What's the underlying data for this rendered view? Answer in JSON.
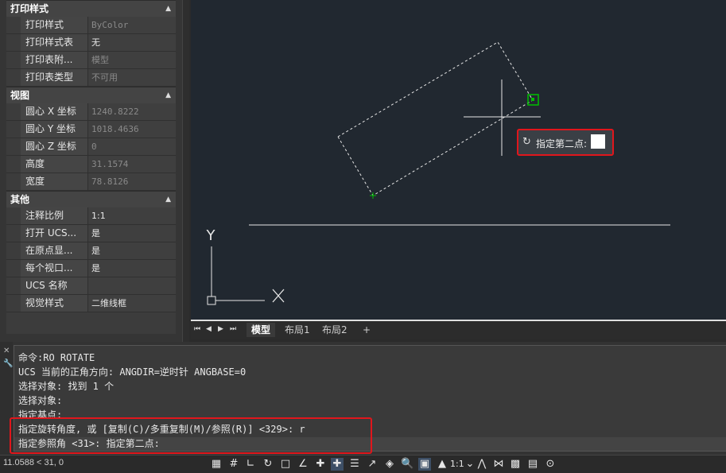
{
  "properties": {
    "sections": [
      {
        "title": "打印样式",
        "rows": [
          {
            "key": "打印样式",
            "value": "ByColor",
            "dim": true
          },
          {
            "key": "打印样式表",
            "value": "无",
            "dim": false
          },
          {
            "key": "打印表附...",
            "value": "模型",
            "dim": true
          },
          {
            "key": "打印表类型",
            "value": "不可用",
            "dim": true
          }
        ]
      },
      {
        "title": "视图",
        "rows": [
          {
            "key": "圆心 X 坐标",
            "value": "1240.8222",
            "dim": true
          },
          {
            "key": "圆心 Y 坐标",
            "value": "1018.4636",
            "dim": true
          },
          {
            "key": "圆心 Z 坐标",
            "value": "0",
            "dim": true
          },
          {
            "key": "高度",
            "value": "31.1574",
            "dim": true
          },
          {
            "key": "宽度",
            "value": "78.8126",
            "dim": true
          }
        ]
      },
      {
        "title": "其他",
        "rows": [
          {
            "key": "注释比例",
            "value": "1:1",
            "dim": false
          },
          {
            "key": "打开 UCS...",
            "value": "是",
            "dim": false
          },
          {
            "key": "在原点显...",
            "value": "是",
            "dim": false
          },
          {
            "key": "每个视口...",
            "value": "是",
            "dim": false
          },
          {
            "key": "UCS 名称",
            "value": "",
            "dim": false
          },
          {
            "key": "视觉样式",
            "value": "二维线框",
            "dim": false
          }
        ]
      }
    ]
  },
  "drawing": {
    "tooltip_label": "指定第二点:",
    "ucs_y_label": "Y"
  },
  "layout_tabs": {
    "tabs": [
      "模型",
      "布局1",
      "布局2",
      "+"
    ],
    "active": "模型"
  },
  "command": {
    "lines": [
      "命令:RO ROTATE",
      "UCS 当前的正角方向:  ANGDIR=逆时针  ANGBASE=0",
      "选择对象: 找到 1 个",
      "选择对象:",
      "指定基点:",
      "指定旋转角度, 或 [复制(C)/多重复制(M)/参照(R)] <329>:  r",
      "指定参照角 <31>: 指定第二点:"
    ]
  },
  "status": {
    "coordinates": "11.0588 < 31, 0",
    "scale": "1:1"
  },
  "colors": {
    "highlight": "#e0161c",
    "canvas": "#212830",
    "grip": "#00c000"
  }
}
